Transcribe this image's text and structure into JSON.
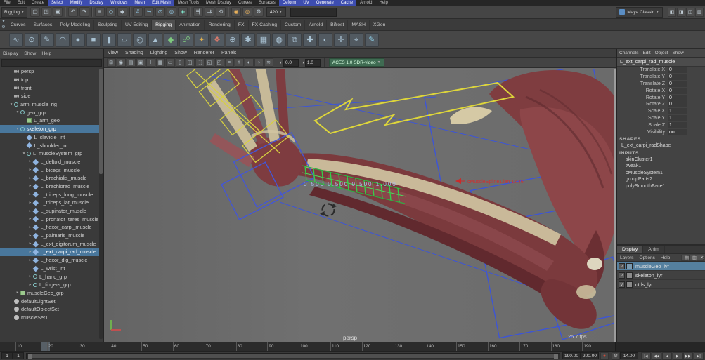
{
  "menu_bar": {
    "items": [
      {
        "label": "File"
      },
      {
        "label": "Edit"
      },
      {
        "label": "Create"
      },
      {
        "label": "Select",
        "hl": true
      },
      {
        "label": "Modify",
        "hl": true
      },
      {
        "label": "Display",
        "hl": true
      },
      {
        "label": "Windows",
        "hl": true
      },
      {
        "label": "Mesh",
        "hl": true
      },
      {
        "label": "Edit Mesh",
        "hl": true
      },
      {
        "label": "Mesh Tools"
      },
      {
        "label": "Mesh Display"
      },
      {
        "label": "Curves"
      },
      {
        "label": "Surfaces"
      },
      {
        "label": "Deform",
        "hl": true
      },
      {
        "label": "UV",
        "hl": true
      },
      {
        "label": "Generate",
        "hl": true
      },
      {
        "label": "Cache",
        "hl": true
      },
      {
        "label": "Arnold"
      },
      {
        "label": "Help"
      }
    ]
  },
  "status_line": {
    "menu_set": "Rigging",
    "icons": [
      {
        "name": "new-scene-icon",
        "glyph": "▢"
      },
      {
        "name": "open-scene-icon",
        "glyph": "◳"
      },
      {
        "name": "save-scene-icon",
        "glyph": "▣"
      },
      {
        "sep": true
      },
      {
        "name": "undo-icon",
        "glyph": "↶"
      },
      {
        "name": "redo-icon",
        "glyph": "↷"
      },
      {
        "sep": true
      },
      {
        "name": "select-hierarchy-icon",
        "glyph": "≡"
      },
      {
        "name": "select-object-icon",
        "glyph": "◇",
        "fg": "#9fd0e8"
      },
      {
        "name": "select-component-icon",
        "glyph": "◆"
      },
      {
        "sep": true
      },
      {
        "name": "snap-grid-icon",
        "glyph": "#",
        "fg": "#8fc4e0"
      },
      {
        "name": "snap-curve-icon",
        "glyph": "↪",
        "fg": "#8fc4e0"
      },
      {
        "name": "snap-point-icon",
        "glyph": "⊙",
        "fg": "#8fc4e0"
      },
      {
        "name": "snap-plane-icon",
        "glyph": "◎",
        "fg": "#8fc4e0"
      },
      {
        "name": "make-live-icon",
        "glyph": "◈",
        "fg": "#7ee0c8"
      },
      {
        "sep": true
      },
      {
        "name": "input-connections-icon",
        "glyph": "⇶"
      },
      {
        "name": "output-connections-icon",
        "glyph": "⇉"
      },
      {
        "name": "construction-history-icon",
        "glyph": "⟲"
      },
      {
        "sep": true
      },
      {
        "name": "render-icon",
        "glyph": "◉",
        "fg": "#e8b05a"
      },
      {
        "name": "ipr-render-icon",
        "glyph": "◎",
        "fg": "#e8b05a"
      },
      {
        "name": "render-settings-icon",
        "glyph": "⚙"
      }
    ],
    "field_value": "420",
    "entry_value": "",
    "workspace_label": "Maya Classic",
    "toggles": [
      {
        "name": "modeling-toolkit-toggle",
        "glyph": "◧"
      },
      {
        "name": "hypershade-toggle",
        "glyph": "◨"
      },
      {
        "name": "attribute-editor-toggle",
        "glyph": "◫"
      },
      {
        "name": "channel-box-toggle",
        "glyph": "▥"
      }
    ]
  },
  "shelf": {
    "tabs": [
      {
        "label": "Curves"
      },
      {
        "label": "Surfaces"
      },
      {
        "label": "Poly Modeling"
      },
      {
        "label": "Sculpting"
      },
      {
        "label": "UV Editing"
      },
      {
        "label": "Rigging",
        "active": true
      },
      {
        "label": "Animation"
      },
      {
        "label": "Rendering"
      },
      {
        "label": "FX"
      },
      {
        "label": "FX Caching"
      },
      {
        "label": "Custom"
      },
      {
        "label": "Arnold"
      },
      {
        "label": "Bifrost"
      },
      {
        "label": "MASH"
      },
      {
        "label": "XGen"
      }
    ],
    "icons": [
      {
        "name": "curve-cv-icon",
        "glyph": "∿"
      },
      {
        "name": "curve-ep-icon",
        "glyph": "⊙"
      },
      {
        "name": "pencil-curve-icon",
        "glyph": "✎"
      },
      {
        "name": "arc-tool-icon",
        "glyph": "◠"
      },
      {
        "name": "poly-sphere-icon",
        "glyph": "●"
      },
      {
        "name": "poly-cube-icon",
        "glyph": "■"
      },
      {
        "name": "poly-cylinder-icon",
        "glyph": "▮"
      },
      {
        "name": "poly-plane-icon",
        "glyph": "▱"
      },
      {
        "name": "poly-torus-icon",
        "glyph": "◎"
      },
      {
        "name": "poly-cone-icon",
        "glyph": "▲"
      },
      {
        "name": "joint-tool-icon",
        "glyph": "◆",
        "fg": "#7ec97e"
      },
      {
        "name": "ik-handle-icon",
        "glyph": "☍",
        "fg": "#7ec97e"
      },
      {
        "name": "skin-bind-icon",
        "glyph": "✦",
        "fg": "#e0b050"
      },
      {
        "name": "muscle-icon",
        "glyph": "❖",
        "fg": "#d97b6c"
      },
      {
        "name": "constraint-icon",
        "glyph": "⊕"
      },
      {
        "name": "cluster-icon",
        "glyph": "✱"
      },
      {
        "name": "lattice-icon",
        "glyph": "▦"
      },
      {
        "name": "wrap-deformer-icon",
        "glyph": "◍"
      },
      {
        "name": "blendshape-icon",
        "glyph": "⧉"
      },
      {
        "name": "control-curve-icon",
        "glyph": "✚"
      },
      {
        "name": "mirror-icon",
        "glyph": "◐"
      },
      {
        "name": "locator-icon",
        "glyph": "✛"
      },
      {
        "name": "measure-icon",
        "glyph": "⌖"
      },
      {
        "name": "paint-weights-icon",
        "glyph": "✎",
        "fg": "#8fd0e8"
      }
    ]
  },
  "outliner": {
    "menus": [
      "Display",
      "Show",
      "Help"
    ],
    "items": [
      {
        "exp": "",
        "icon": "camera",
        "label": "persp",
        "indent": 1
      },
      {
        "exp": "",
        "icon": "camera",
        "label": "top",
        "indent": 1
      },
      {
        "exp": "",
        "icon": "camera",
        "label": "front",
        "indent": 1
      },
      {
        "exp": "",
        "icon": "camera",
        "label": "side",
        "indent": 1
      },
      {
        "exp": "▾",
        "icon": "group",
        "label": "arm_muscle_rig",
        "indent": 1
      },
      {
        "exp": "▾",
        "icon": "group",
        "label": "geo_grp",
        "indent": 2
      },
      {
        "exp": "",
        "icon": "mesh",
        "label": "L_arm_geo",
        "indent": 3
      },
      {
        "exp": "▾",
        "icon": "group",
        "label": "skeleton_grp",
        "indent": 2,
        "selected": true
      },
      {
        "exp": "",
        "icon": "joint",
        "label": "L_clavicle_jnt",
        "indent": 3
      },
      {
        "exp": "",
        "icon": "joint",
        "label": "L_shoulder_jnt",
        "indent": 3
      },
      {
        "exp": "▾",
        "icon": "group",
        "label": "L_muscleSystem_grp",
        "indent": 3
      },
      {
        "exp": "▸",
        "icon": "joint",
        "label": "L_deltoid_muscle",
        "indent": 4
      },
      {
        "exp": "▸",
        "icon": "joint",
        "label": "L_biceps_muscle",
        "indent": 4
      },
      {
        "exp": "▸",
        "icon": "joint",
        "label": "L_brachialis_muscle",
        "indent": 4
      },
      {
        "exp": "▸",
        "icon": "joint",
        "label": "L_brachiorad_muscle",
        "indent": 4
      },
      {
        "exp": "▸",
        "icon": "joint",
        "label": "L_triceps_long_muscle",
        "indent": 4
      },
      {
        "exp": "▸",
        "icon": "joint",
        "label": "L_triceps_lat_muscle",
        "indent": 4
      },
      {
        "exp": "▸",
        "icon": "joint",
        "label": "L_supinator_muscle",
        "indent": 4
      },
      {
        "exp": "▸",
        "icon": "joint",
        "label": "L_pronator_teres_muscle",
        "indent": 4
      },
      {
        "exp": "▸",
        "icon": "joint",
        "label": "L_flexor_carpi_muscle",
        "indent": 4
      },
      {
        "exp": "▸",
        "icon": "joint",
        "label": "L_palmaris_muscle",
        "indent": 4
      },
      {
        "exp": "▸",
        "icon": "joint",
        "label": "L_ext_digitorum_muscle",
        "indent": 4
      },
      {
        "exp": "▸",
        "icon": "joint",
        "label": "L_ext_carpi_rad_muscle",
        "indent": 4,
        "selected": true
      },
      {
        "exp": "▸",
        "icon": "joint",
        "label": "L_flexor_dig_muscle",
        "indent": 4
      },
      {
        "exp": "",
        "icon": "joint",
        "label": "L_wrist_jnt",
        "indent": 4
      },
      {
        "exp": "▸",
        "icon": "group",
        "label": "L_hand_grp",
        "indent": 4
      },
      {
        "exp": "▸",
        "icon": "group",
        "label": "L_fingers_grp",
        "indent": 4
      },
      {
        "exp": "▸",
        "icon": "mesh",
        "label": "muscleGeo_grp",
        "indent": 2
      },
      {
        "exp": "",
        "icon": "set",
        "label": "defaultLightSet",
        "indent": 1
      },
      {
        "exp": "",
        "icon": "set",
        "label": "defaultObjectSet",
        "indent": 1
      },
      {
        "exp": "",
        "icon": "set",
        "label": "muscleSet1",
        "indent": 1
      }
    ]
  },
  "viewport": {
    "menus": [
      "View",
      "Shading",
      "Lighting",
      "Show",
      "Renderer",
      "Panels"
    ],
    "toolbar_icons": [
      {
        "name": "select-camera-icon",
        "glyph": "⊞"
      },
      {
        "name": "camera-attributes-icon",
        "glyph": "◉"
      },
      {
        "name": "bookmarks-icon",
        "glyph": "▤"
      },
      {
        "name": "image-plane-icon",
        "glyph": "▣"
      },
      {
        "name": "2d-pan-zoom-icon",
        "glyph": "✛"
      },
      {
        "name": "grid-icon",
        "glyph": "▦"
      },
      {
        "name": "film-gate-icon",
        "glyph": "▭"
      },
      {
        "name": "resolution-gate-icon",
        "glyph": "▯"
      },
      {
        "name": "gate-mask-icon",
        "glyph": "◫"
      },
      {
        "name": "field-chart-icon",
        "glyph": "⬚"
      },
      {
        "name": "safe-action-icon",
        "glyph": "◱"
      },
      {
        "name": "safe-title-icon",
        "glyph": "◰"
      },
      {
        "name": "hud-icon",
        "glyph": "≡"
      },
      {
        "name": "lighting-icon",
        "glyph": "☀"
      },
      {
        "name": "shadows-icon",
        "glyph": "◐"
      },
      {
        "name": "ambient-occlusion-icon",
        "glyph": "◑"
      },
      {
        "name": "anti-aliasing-icon",
        "glyph": "≋"
      }
    ],
    "exposure": "0.0",
    "gamma": "1.0",
    "view_transform": "ACES 1.0 SDR-video",
    "camera_label": "persp",
    "fps_label": "25.7 fps",
    "red_annotation": "cMuscleSpline1.len 12.46",
    "hud_values": "0.500    0.500    0.500    1.000"
  },
  "channel_box": {
    "menus": [
      "Channels",
      "Edit",
      "Object",
      "Show"
    ],
    "object_name": "L_ext_carpi_rad_muscle",
    "channels": [
      {
        "label": "Translate X",
        "value": "0"
      },
      {
        "label": "Translate Y",
        "value": "0"
      },
      {
        "label": "Translate Z",
        "value": "0"
      },
      {
        "label": "Rotate X",
        "value": "0"
      },
      {
        "label": "Rotate Y",
        "value": "0"
      },
      {
        "label": "Rotate Z",
        "value": "0"
      },
      {
        "label": "Scale X",
        "value": "1"
      },
      {
        "label": "Scale Y",
        "value": "1"
      },
      {
        "label": "Scale Z",
        "value": "1"
      },
      {
        "label": "Visibility",
        "value": "on"
      }
    ],
    "shapes_header": "SHAPES",
    "shape_name": "L_ext_carpi_radShape",
    "inputs_header": "INPUTS",
    "inputs": [
      "skinCluster1",
      "tweak1",
      "cMuscleSystem1",
      "groupParts2",
      "polySmoothFace1"
    ]
  },
  "layer_editor": {
    "tabs": [
      {
        "label": "Display",
        "active": true
      },
      {
        "label": "Anim"
      }
    ],
    "menus": [
      "Layers",
      "Options",
      "Help"
    ],
    "buttons": [
      {
        "name": "new-empty-layer-button",
        "glyph": "▤"
      },
      {
        "name": "new-layer-from-selected-button",
        "glyph": "▥"
      },
      {
        "name": "delete-layer-button",
        "glyph": "✕"
      }
    ],
    "layers": [
      {
        "vis": "V",
        "color": "#7a9ab0",
        "name": "muscleGeo_lyr",
        "selected": true
      },
      {
        "vis": "V",
        "color": "#8a8a8a",
        "name": "skeleton_lyr"
      },
      {
        "vis": "V",
        "color": "#8a8a8a",
        "name": "ctrls_lyr"
      }
    ]
  },
  "timeline": {
    "ticks": [
      "10",
      "20",
      "30",
      "40",
      "50",
      "60",
      "70",
      "80",
      "90",
      "100",
      "110",
      "120",
      "130",
      "140",
      "150",
      "160",
      "170",
      "180",
      "190"
    ]
  },
  "range_bar": {
    "start_field": "1",
    "min_field": "1",
    "max_field": "190.00",
    "end_field": "200.00",
    "current_frame": "14.00",
    "autokey_glyph": "●",
    "gear_glyph": "⚙",
    "transport": [
      {
        "name": "go-to-start-button",
        "glyph": "|◀"
      },
      {
        "name": "step-back-button",
        "glyph": "◀◀"
      },
      {
        "name": "play-backwards-button",
        "glyph": "◀"
      },
      {
        "name": "play-forwards-button",
        "glyph": "▶"
      },
      {
        "name": "step-forward-button",
        "glyph": "▶▶"
      },
      {
        "name": "go-to-end-button",
        "glyph": "▶|"
      }
    ]
  }
}
